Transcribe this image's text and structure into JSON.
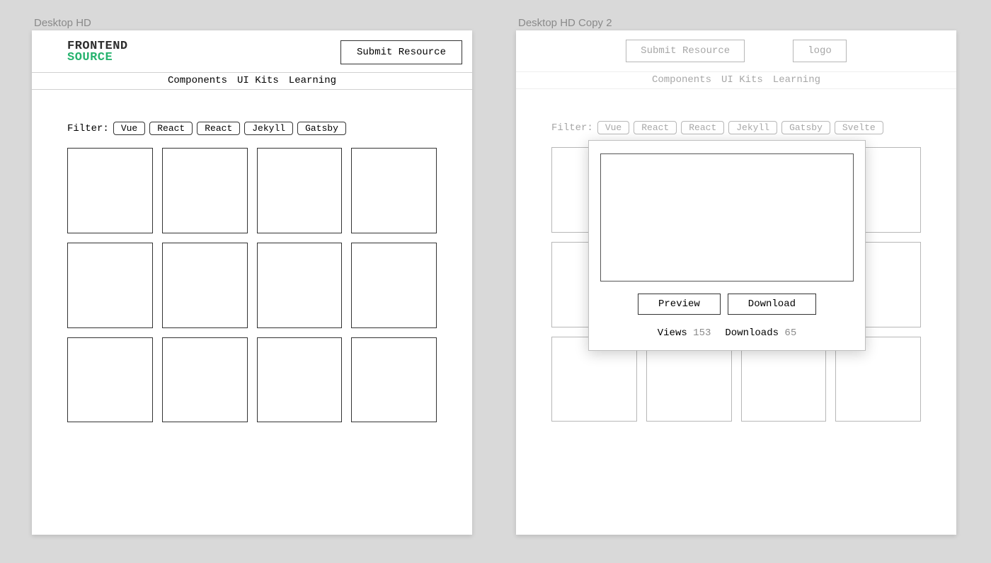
{
  "artboard1": {
    "label": "Desktop HD"
  },
  "artboard2": {
    "label": "Desktop HD Copy 2"
  },
  "logo": {
    "line1": "FRONTEND",
    "line2": "SOURCE"
  },
  "header": {
    "submit": "Submit Resource",
    "logo_placeholder": "logo"
  },
  "nav": {
    "components": "Components",
    "uikits": "UI Kits",
    "learning": "Learning"
  },
  "filter": {
    "label": "Filter:",
    "chips1": [
      "Vue",
      "React",
      "React",
      "Jekyll",
      "Gatsby"
    ],
    "chips2": [
      "Vue",
      "React",
      "React",
      "Jekyll",
      "Gatsby",
      "Svelte"
    ]
  },
  "modal": {
    "preview": "Preview",
    "download": "Download",
    "views_label": "Views",
    "views_value": "153",
    "downloads_label": "Downloads",
    "downloads_value": "65"
  }
}
